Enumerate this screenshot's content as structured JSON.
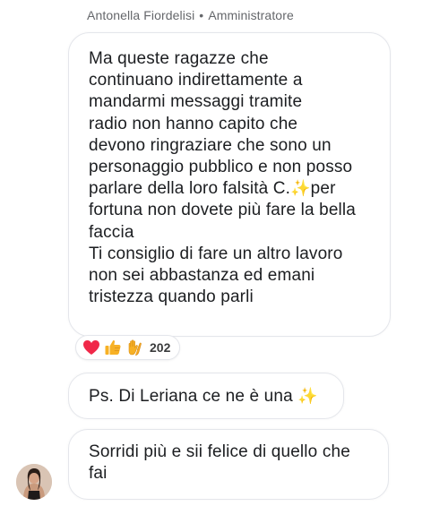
{
  "header": {
    "author_name": "Antonella Fiordelisi",
    "separator": "•",
    "author_role": "Amministratore"
  },
  "messages": [
    {
      "lines": [
        "Ma queste ragazze che",
        "continuano indirettamente a",
        "mandarmi messaggi tramite",
        "radio non hanno capito che",
        "devono ringraziare che sono un",
        "personaggio pubblico e non posso"
      ],
      "line7_before": "parlare della loro falsità C.",
      "line7_after": "per",
      "lines_end": [
        "fortuna non dovete più fare la bella",
        "faccia",
        "Ti consiglio di fare un altro lavoro",
        "non sei abbastanza ed emani",
        "tristezza quando parli"
      ],
      "sparkle": "✨"
    },
    {
      "text": "Ps. Di Leriana ce ne è una",
      "sparkle": "✨"
    },
    {
      "lines": [
        "Sorridi più e sii felice di quello che",
        "fai"
      ]
    }
  ],
  "reactions": {
    "icons": [
      "heart-reaction-icon",
      "thumbs-up-reaction-icon",
      "clap-reaction-icon"
    ],
    "count": "202",
    "colors": {
      "heart": "#f02849",
      "thumbs": "#f7b125",
      "clap": "#f7b125"
    }
  }
}
